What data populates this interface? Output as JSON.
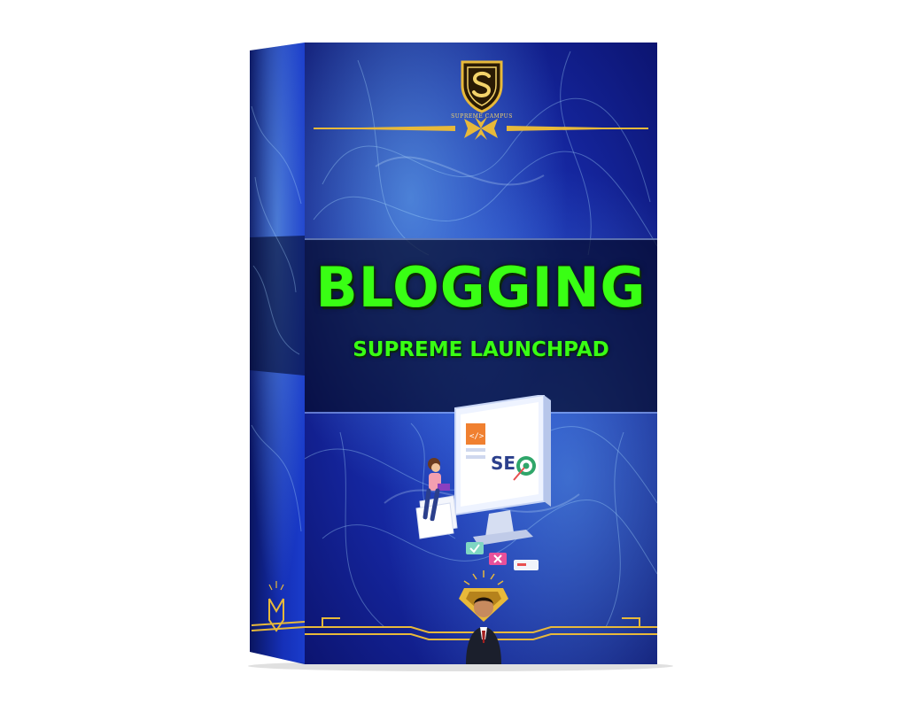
{
  "product": {
    "title": "BLOGGING",
    "subtitle": "SUPREME LAUNCHPAD",
    "logo_text": "SUPREME CAMPUS",
    "illustration_text": "SEO"
  },
  "icons": {
    "logo": "shield-s-logo-icon",
    "ornament": "gold-divider-ornament-icon",
    "illustration": "seo-computer-illustration-icon",
    "author": "author-portrait-icon"
  },
  "colors": {
    "title": "#39ff14",
    "gold": "#e8b93a",
    "box_blue": "#1d3fd0",
    "band": "#040a2d"
  }
}
